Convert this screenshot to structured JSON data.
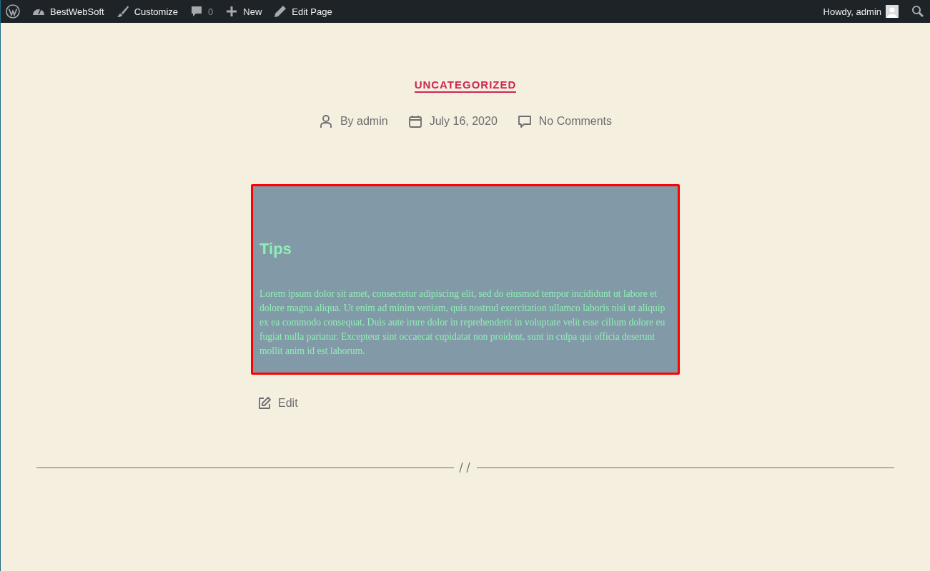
{
  "admin_bar": {
    "left": [
      {
        "kind": "logo"
      },
      {
        "kind": "dashboard",
        "label": "BestWebSoft"
      },
      {
        "kind": "brush",
        "label": "Customize"
      },
      {
        "kind": "comment",
        "label": "0"
      },
      {
        "kind": "plus",
        "label": "New"
      },
      {
        "kind": "pencil",
        "label": "Edit Page"
      }
    ],
    "greeting": "Howdy, admin"
  },
  "post": {
    "category": "UNCATEGORIZED",
    "meta": [
      {
        "kind": "author",
        "label": "By admin"
      },
      {
        "kind": "date",
        "label": "July 16, 2020"
      },
      {
        "kind": "comments",
        "label": "No Comments"
      }
    ],
    "box": {
      "heading": "Tips",
      "text": "Lorem ipsum dolor sit amet, consectetur adipiscing elit, sed do eiusmod tempor incididunt ut labore et dolore magna aliqua. Ut enim ad minim veniam, quis nostrud exercitation ullamco laboris nisi ut aliquip ex ea commodo consequat. Duis aute irure dolor in reprehenderit in voluptate velit esse cillum dolore eu fugiat nulla pariatur. Excepteur sint occaecat cupidatat non proident, sunt in culpa qui officia deserunt mollit anim id est laborum."
    },
    "edit_link": "Edit"
  }
}
